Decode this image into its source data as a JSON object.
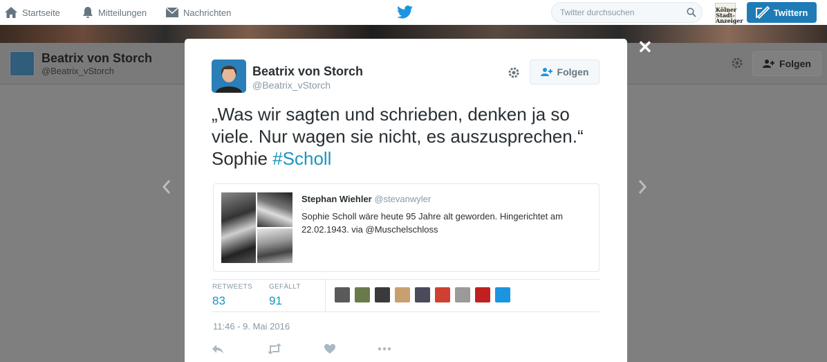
{
  "nav": {
    "home": "Startseite",
    "notifications": "Mitteilungen",
    "messages": "Nachrichten",
    "search_placeholder": "Twitter durchsuchen",
    "account_avatar_text": "Kölner Stadt-Anzeiger",
    "tweet_button": "Twittern"
  },
  "profile_header": {
    "name": "Beatrix von Storch",
    "handle": "@Beatrix_vStorch",
    "follow_label": "Folgen"
  },
  "tweet": {
    "author_name": "Beatrix von Storch",
    "author_handle": "@Beatrix_vStorch",
    "follow_label": "Folgen",
    "text_main": "„Was wir sagten und schrieben, denken ja so viele. Nur wagen sie nicht, es auszusprechen.“ Sophie ",
    "hashtag": "#Scholl",
    "quote": {
      "author_name": "Stephan Wiehler",
      "author_handle": "@stevanwyler",
      "text": "Sophie Scholl wäre heute 95 Jahre alt geworden. Hingerichtet am 22.02.1943. via @Muschelschloss"
    },
    "stats": {
      "retweets_label": "RETWEETS",
      "retweets": "83",
      "likes_label": "GEFÄLLT",
      "likes": "91"
    },
    "likers": [
      "#5a5a5a",
      "#6b7a4a",
      "#3a3a3a",
      "#c8a070",
      "#4a4a5a",
      "#d04030",
      "#9a9a9a",
      "#c02020",
      "#1b95e0"
    ],
    "timestamp": "11:46 - 9. Mai 2016"
  },
  "colors": {
    "twitter_blue": "#1b95c0",
    "tweet_button": "#1f7bb5"
  }
}
